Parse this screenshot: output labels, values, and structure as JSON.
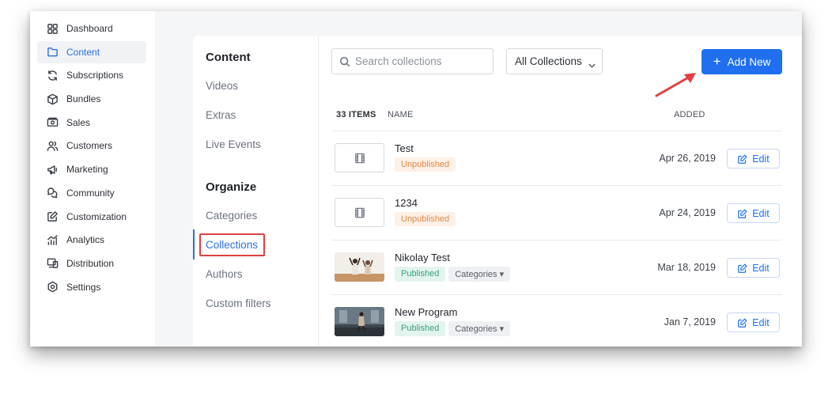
{
  "sidebar": {
    "items": [
      {
        "label": "Dashboard",
        "icon": "dashboard-icon"
      },
      {
        "label": "Content",
        "icon": "folder-icon",
        "active": true
      },
      {
        "label": "Subscriptions",
        "icon": "refresh-icon"
      },
      {
        "label": "Bundles",
        "icon": "box-icon"
      },
      {
        "label": "Sales",
        "icon": "money-icon"
      },
      {
        "label": "Customers",
        "icon": "users-icon"
      },
      {
        "label": "Marketing",
        "icon": "megaphone-icon"
      },
      {
        "label": "Community",
        "icon": "chat-icon"
      },
      {
        "label": "Customization",
        "icon": "edit-square-icon"
      },
      {
        "label": "Analytics",
        "icon": "analytics-icon"
      },
      {
        "label": "Distribution",
        "icon": "devices-icon"
      },
      {
        "label": "Settings",
        "icon": "gear-icon"
      }
    ]
  },
  "subnav": {
    "content_heading": "Content",
    "content_links": [
      "Videos",
      "Extras",
      "Live Events"
    ],
    "organize_heading": "Organize",
    "organize_links": [
      "Categories",
      "Collections",
      "Authors",
      "Custom filters"
    ],
    "active": "Collections"
  },
  "toolbar": {
    "search_placeholder": "Search collections",
    "filter_label": "All Collections",
    "add_label": "Add New"
  },
  "table": {
    "count_label": "33 ITEMS",
    "name_header": "NAME",
    "added_header": "ADDED",
    "edit_label": "Edit",
    "category_label": "Categories",
    "rows": [
      {
        "title": "Test",
        "status": "Unpublished",
        "date": "Apr 26, 2019",
        "thumbnail": "film-icon"
      },
      {
        "title": "1234",
        "status": "Unpublished",
        "date": "Apr 24, 2019",
        "thumbnail": "film-icon"
      },
      {
        "title": "Nikolay Test",
        "status": "Published",
        "date": "Mar 18, 2019",
        "thumbnail": "photo-dancers",
        "has_categories": true
      },
      {
        "title": "New Program",
        "status": "Published",
        "date": "Jan 7, 2019",
        "thumbnail": "photo-studio",
        "has_categories": true
      }
    ]
  },
  "colors": {
    "accent": "#1f6ff0",
    "highlight_box": "#e04040",
    "arrow": "#e04040",
    "published_bg": "#e3f4ef",
    "unpublished_bg": "#fdf0e6"
  }
}
